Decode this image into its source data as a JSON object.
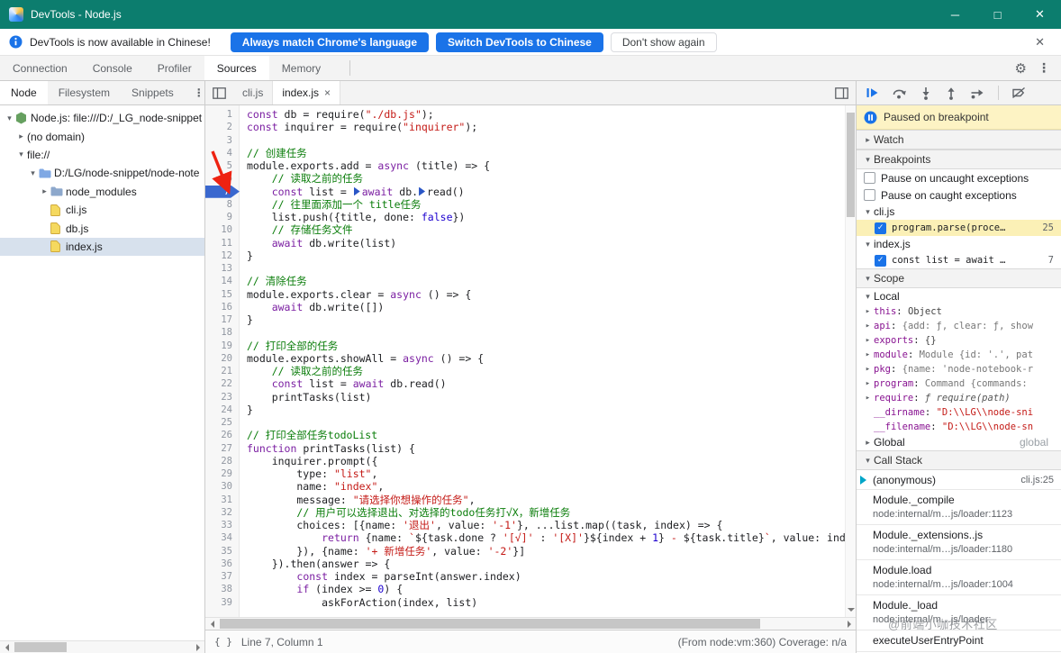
{
  "icons": {
    "gear": "⚙",
    "kebab": "⋮",
    "chevron_down": "▾",
    "chevron_right": "▸",
    "close": "✕",
    "tab_close": "×",
    "check": "✓"
  },
  "punct": {
    "colon": ": "
  },
  "window": {
    "title": "DevTools - Node.js",
    "controls": {
      "minimize": "─",
      "maximize": "□",
      "close": "✕"
    }
  },
  "notification": {
    "text": "DevTools is now available in Chinese!",
    "buttons": [
      {
        "label": "Always match Chrome's language",
        "style": "primary"
      },
      {
        "label": "Switch DevTools to Chinese",
        "style": "primary"
      },
      {
        "label": "Don't show again",
        "style": "secondary"
      }
    ]
  },
  "main_tabs": [
    {
      "label": "Connection",
      "selected": false
    },
    {
      "label": "Console",
      "selected": false
    },
    {
      "label": "Profiler",
      "selected": false
    },
    {
      "label": "Sources",
      "selected": true
    },
    {
      "label": "Memory",
      "selected": false
    }
  ],
  "sidebar": {
    "tabs": [
      {
        "label": "Node",
        "selected": true
      },
      {
        "label": "Filesystem",
        "selected": false
      },
      {
        "label": "Snippets",
        "selected": false
      }
    ],
    "tree": [
      {
        "depth": 0,
        "twisty": "open",
        "icon": "node",
        "label": "Node.js: file:///D:/_LG_node-snippet"
      },
      {
        "depth": 1,
        "twisty": "closed",
        "icon": "",
        "label": "(no domain)"
      },
      {
        "depth": 1,
        "twisty": "open",
        "icon": "",
        "label": "file://"
      },
      {
        "depth": 2,
        "twisty": "open",
        "icon": "folder-blue",
        "label": "D:/LG/node-snippet/node-note"
      },
      {
        "depth": 3,
        "twisty": "closed",
        "icon": "folder",
        "label": "node_modules"
      },
      {
        "depth": 3,
        "twisty": "none",
        "icon": "file-js",
        "label": "cli.js"
      },
      {
        "depth": 3,
        "twisty": "none",
        "icon": "file-js",
        "label": "db.js"
      },
      {
        "depth": 3,
        "twisty": "none",
        "icon": "file-js",
        "label": "index.js",
        "selected": true
      }
    ]
  },
  "editor": {
    "tabs": [
      {
        "label": "cli.js",
        "active": false,
        "closable": false
      },
      {
        "label": "index.js",
        "active": true,
        "closable": true
      }
    ],
    "lines": [
      {
        "n": 1,
        "t": [
          [
            "kw",
            "const"
          ],
          [
            "pl",
            " db = require("
          ],
          [
            "str",
            "\"./db.js\""
          ],
          [
            "pl",
            ");"
          ]
        ]
      },
      {
        "n": 2,
        "t": [
          [
            "kw",
            "const"
          ],
          [
            "pl",
            " inquirer = require("
          ],
          [
            "str",
            "\"inquirer\""
          ],
          [
            "pl",
            ");"
          ]
        ]
      },
      {
        "n": 3,
        "t": []
      },
      {
        "n": 4,
        "t": [
          [
            "com",
            "// 创建任务"
          ]
        ]
      },
      {
        "n": 5,
        "t": [
          [
            "pl",
            "module.exports.add = "
          ],
          [
            "kw",
            "async"
          ],
          [
            "pl",
            " (title) => {"
          ]
        ]
      },
      {
        "n": 6,
        "t": [
          [
            "pl",
            "    "
          ],
          [
            "com",
            "// 读取之前的任务"
          ]
        ]
      },
      {
        "n": 7,
        "bp": true,
        "t": [
          [
            "pl",
            "    "
          ],
          [
            "kw",
            "const"
          ],
          [
            "pl",
            " list = "
          ],
          [
            "mk",
            ""
          ],
          [
            "kw",
            "await"
          ],
          [
            "pl",
            " db."
          ],
          [
            "mk",
            ""
          ],
          [
            "pl",
            "read()"
          ]
        ]
      },
      {
        "n": 8,
        "t": [
          [
            "pl",
            "    "
          ],
          [
            "com",
            "// 往里面添加一个 title任务"
          ]
        ]
      },
      {
        "n": 9,
        "t": [
          [
            "pl",
            "    list.push({title, done: "
          ],
          [
            "atom",
            "false"
          ],
          [
            "pl",
            "})"
          ]
        ]
      },
      {
        "n": 10,
        "t": [
          [
            "pl",
            "    "
          ],
          [
            "com",
            "// 存储任务文件"
          ]
        ]
      },
      {
        "n": 11,
        "t": [
          [
            "pl",
            "    "
          ],
          [
            "kw",
            "await"
          ],
          [
            "pl",
            " db.write(list)"
          ]
        ]
      },
      {
        "n": 12,
        "t": [
          [
            "pl",
            "}"
          ]
        ]
      },
      {
        "n": 13,
        "t": []
      },
      {
        "n": 14,
        "t": [
          [
            "com",
            "// 清除任务"
          ]
        ]
      },
      {
        "n": 15,
        "t": [
          [
            "pl",
            "module.exports.clear = "
          ],
          [
            "kw",
            "async"
          ],
          [
            "pl",
            " () => {"
          ]
        ]
      },
      {
        "n": 16,
        "t": [
          [
            "pl",
            "    "
          ],
          [
            "kw",
            "await"
          ],
          [
            "pl",
            " db.write([])"
          ]
        ]
      },
      {
        "n": 17,
        "t": [
          [
            "pl",
            "}"
          ]
        ]
      },
      {
        "n": 18,
        "t": []
      },
      {
        "n": 19,
        "t": [
          [
            "com",
            "// 打印全部的任务"
          ]
        ]
      },
      {
        "n": 20,
        "t": [
          [
            "pl",
            "module.exports.showAll = "
          ],
          [
            "kw",
            "async"
          ],
          [
            "pl",
            " () => {"
          ]
        ]
      },
      {
        "n": 21,
        "t": [
          [
            "pl",
            "    "
          ],
          [
            "com",
            "// 读取之前的任务"
          ]
        ]
      },
      {
        "n": 22,
        "t": [
          [
            "pl",
            "    "
          ],
          [
            "kw",
            "const"
          ],
          [
            "pl",
            " list = "
          ],
          [
            "kw",
            "await"
          ],
          [
            "pl",
            " db.read()"
          ]
        ]
      },
      {
        "n": 23,
        "t": [
          [
            "pl",
            "    printTasks(list)"
          ]
        ]
      },
      {
        "n": 24,
        "t": [
          [
            "pl",
            "}"
          ]
        ]
      },
      {
        "n": 25,
        "t": []
      },
      {
        "n": 26,
        "t": [
          [
            "com",
            "// 打印全部任务todoList"
          ]
        ]
      },
      {
        "n": 27,
        "t": [
          [
            "kw",
            "function"
          ],
          [
            "pl",
            " printTasks(list) {"
          ]
        ]
      },
      {
        "n": 28,
        "t": [
          [
            "pl",
            "    inquirer.prompt({"
          ]
        ]
      },
      {
        "n": 29,
        "t": [
          [
            "pl",
            "        type: "
          ],
          [
            "str",
            "\"list\""
          ],
          [
            "pl",
            ","
          ]
        ]
      },
      {
        "n": 30,
        "t": [
          [
            "pl",
            "        name: "
          ],
          [
            "str",
            "\"index\""
          ],
          [
            "pl",
            ","
          ]
        ]
      },
      {
        "n": 31,
        "t": [
          [
            "pl",
            "        message: "
          ],
          [
            "str",
            "\"请选择你想操作的任务\""
          ],
          [
            "pl",
            ","
          ]
        ]
      },
      {
        "n": 32,
        "t": [
          [
            "pl",
            "        "
          ],
          [
            "com",
            "// 用户可以选择退出、对选择的todo任务打√X，新增任务"
          ]
        ]
      },
      {
        "n": 33,
        "t": [
          [
            "pl",
            "        choices: [{name: "
          ],
          [
            "str",
            "'退出'"
          ],
          [
            "pl",
            ", value: "
          ],
          [
            "str",
            "'-1'"
          ],
          [
            "pl",
            "}, ...list.map((task, index) => {"
          ]
        ]
      },
      {
        "n": 34,
        "t": [
          [
            "pl",
            "            "
          ],
          [
            "kw",
            "return"
          ],
          [
            "pl",
            " {name: "
          ],
          [
            "str",
            "`"
          ],
          [
            "pl",
            "${task.done ? "
          ],
          [
            "str",
            "'[√]'"
          ],
          [
            "pl",
            " : "
          ],
          [
            "str",
            "'[X]'"
          ],
          [
            "pl",
            "}${index + "
          ],
          [
            "num",
            "1"
          ],
          [
            "pl",
            "}"
          ],
          [
            "str",
            " - "
          ],
          [
            "pl",
            "${task.title}"
          ],
          [
            "str",
            "`"
          ],
          [
            "pl",
            ", value: index.t"
          ]
        ]
      },
      {
        "n": 35,
        "t": [
          [
            "pl",
            "        }), {name: "
          ],
          [
            "str",
            "'+ 新增任务'"
          ],
          [
            "pl",
            ", value: "
          ],
          [
            "str",
            "'-2'"
          ],
          [
            "pl",
            "}]"
          ]
        ]
      },
      {
        "n": 36,
        "t": [
          [
            "pl",
            "    }).then(answer => {"
          ]
        ]
      },
      {
        "n": 37,
        "t": [
          [
            "pl",
            "        "
          ],
          [
            "kw",
            "const"
          ],
          [
            "pl",
            " index = parseInt(answer.index)"
          ]
        ]
      },
      {
        "n": 38,
        "t": [
          [
            "pl",
            "        "
          ],
          [
            "kw",
            "if"
          ],
          [
            "pl",
            " (index >= "
          ],
          [
            "num",
            "0"
          ],
          [
            "pl",
            ") {"
          ]
        ]
      },
      {
        "n": 39,
        "t": [
          [
            "pl",
            "            askForAction(index, list)"
          ]
        ]
      }
    ]
  },
  "debugger": {
    "toolbar": [
      "resume",
      "step-over",
      "step-into",
      "step-out",
      "step",
      "deactivate-breakpoints"
    ],
    "paused_message": "Paused on breakpoint",
    "watch": {
      "title": "Watch"
    },
    "breakpoints": {
      "title": "Breakpoints",
      "toggles": [
        {
          "label": "Pause on uncaught exceptions",
          "checked": false
        },
        {
          "label": "Pause on caught exceptions",
          "checked": false
        }
      ],
      "groups": [
        {
          "file": "cli.js",
          "entries": [
            {
              "checked": true,
              "snippet": "program.parse(proce…",
              "line": "25",
              "active": true
            }
          ]
        },
        {
          "file": "index.js",
          "entries": [
            {
              "checked": true,
              "snippet": "const list = await …",
              "line": "7",
              "active": false
            }
          ]
        }
      ]
    },
    "scope": {
      "title": "Scope",
      "groups": [
        {
          "name": "Local",
          "state": "open",
          "note": ""
        },
        {
          "name": "Global",
          "state": "closed",
          "note": "global"
        }
      ],
      "locals": [
        {
          "exp": true,
          "name": "this",
          "value": "Object",
          "vtype": "obj"
        },
        {
          "exp": true,
          "name": "api",
          "value": "{add: ƒ, clear: ƒ, show",
          "vtype": "preview"
        },
        {
          "exp": true,
          "name": "exports",
          "value": "{}",
          "vtype": "obj"
        },
        {
          "exp": true,
          "name": "module",
          "value": "Module {id: '.', pat",
          "vtype": "preview"
        },
        {
          "exp": true,
          "name": "pkg",
          "value": "{name: 'node-notebook-r",
          "vtype": "preview"
        },
        {
          "exp": true,
          "name": "program",
          "value": "Command {commands:",
          "vtype": "preview"
        },
        {
          "exp": true,
          "name": "require",
          "value": "ƒ require(path)",
          "vtype": "fn"
        },
        {
          "exp": false,
          "name": "__dirname",
          "value": "\"D:\\\\LG\\\\node-sni",
          "vtype": "str"
        },
        {
          "exp": false,
          "name": "__filename",
          "value": "\"D:\\\\LG\\\\node-sn",
          "vtype": "str"
        }
      ]
    },
    "call_stack": {
      "title": "Call Stack",
      "frames": [
        {
          "name": "(anonymous)",
          "location": "cli.js:25",
          "current": true,
          "inline": true
        },
        {
          "name": "Module._compile",
          "location": "node:internal/m…js/loader:1123"
        },
        {
          "name": "Module._extensions..js",
          "location": "node:internal/m…js/loader:1180"
        },
        {
          "name": "Module.load",
          "location": "node:internal/m…js/loader:1004"
        },
        {
          "name": "Module._load",
          "location": "node:internal/m…js/loader:"
        },
        {
          "name": "executeUserEntryPoint",
          "location": ""
        }
      ]
    }
  },
  "status": {
    "braces": "{ }",
    "line_info": "Line 7, Column 1",
    "right": "(From node:vm:360) Coverage: n/a"
  },
  "watermark": "@前端小咖技术社区"
}
